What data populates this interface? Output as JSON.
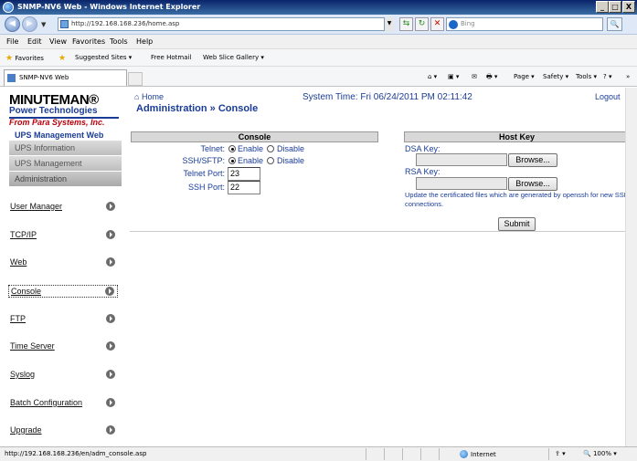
{
  "window": {
    "title": "SNMP-NV6 Web - Windows Internet Explorer",
    "min": "_",
    "max": "□",
    "close": "X"
  },
  "addressbar": {
    "url": "http://192.168.168.236/home.asp",
    "search_placeholder": "Bing",
    "back_glyph": "◀",
    "fwd_glyph": "▶",
    "search_glyph": "🔍",
    "go_glyph": "⇆",
    "refresh_glyph": "↻",
    "stop_glyph": "✕"
  },
  "menubar": {
    "items": [
      "File",
      "Edit",
      "View",
      "Favorites",
      "Tools",
      "Help"
    ]
  },
  "favbar": {
    "favorites": "Favorites",
    "suggested": "Suggested Sites ▾",
    "hotmail": "Free Hotmail",
    "webslice": "Web Slice Gallery ▾"
  },
  "tabbar": {
    "tab_title": "SNMP-NV6 Web",
    "commands": [
      "Page ▾",
      "Safety ▾",
      "Tools ▾"
    ],
    "cmd_glyphs": [
      "⌂ ▾",
      "▣ ▾",
      "✉",
      "🖶 ▾",
      "? ▾",
      "»"
    ]
  },
  "logo": {
    "brand": "MINUTEMAN®",
    "line2": "Power Technologies",
    "line3": "From Para Systems, Inc."
  },
  "sidebar": {
    "app_name": "UPS Management Web",
    "sections": [
      "UPS Information",
      "UPS Management",
      "Administration"
    ],
    "items": [
      "User Manager",
      "TCP/IP",
      "Web",
      "Console",
      "FTP",
      "Time Server",
      "Syslog",
      "Batch Configuration",
      "Upgrade"
    ]
  },
  "header": {
    "home": "Home",
    "breadcrumb": "Administration » Console",
    "system_time": "System Time: Fri 06/24/2011 PM 02:11:42",
    "logout": "Logout"
  },
  "console": {
    "title": "Console",
    "telnet_label": "Telnet:",
    "sshsftp_label": "SSH/SFTP:",
    "enable": "Enable",
    "disable": "Disable",
    "telnet_enabled": true,
    "ssh_enabled": true,
    "telnet_port_label": "Telnet Port:",
    "telnet_port": "23",
    "ssh_port_label": "SSH Port:",
    "ssh_port": "22"
  },
  "hostkey": {
    "title": "Host Key",
    "dsa_label": "DSA Key:",
    "rsa_label": "RSA Key:",
    "browse": "Browse...",
    "note": "Update the certificated files which are generated by openssh for new SSH connections.",
    "submit": "Submit"
  },
  "statusbar": {
    "url": "http://192.168.168.236/en/adm_console.asp",
    "zone": "Internet",
    "zoom": "100%"
  }
}
